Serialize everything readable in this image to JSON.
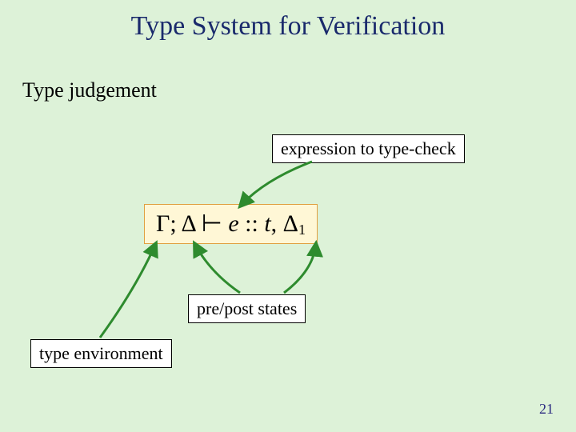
{
  "title": "Type System for Verification",
  "section_heading": "Type judgement",
  "labels": {
    "expr": "expression to type-check",
    "prepost": "pre/post states",
    "typeenv": "type environment"
  },
  "formula": {
    "gamma": "Γ",
    "sep1": "; ",
    "delta": "Δ",
    "vdash": " ⊢ ",
    "e": "e",
    "coloncolon": " :: ",
    "t": "t",
    "comma": ", ",
    "delta1": "Δ",
    "sub1": "1"
  },
  "page_number": "21"
}
